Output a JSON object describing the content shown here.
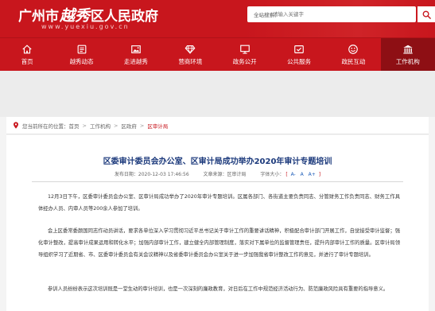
{
  "header": {
    "site_name_prefix": "广州市",
    "site_name_brush": "越秀",
    "site_name_suffix": "区人民政府",
    "domain": "www.yuexiu.gov.cn",
    "search_label": "全站搜索：",
    "search_placeholder": "请输入关键字"
  },
  "nav": {
    "items": [
      {
        "label": "首页",
        "icon": "home-icon"
      },
      {
        "label": "越秀动态",
        "icon": "newspaper-icon"
      },
      {
        "label": "走进越秀",
        "icon": "picture-icon"
      },
      {
        "label": "营商环境",
        "icon": "diamond-icon"
      },
      {
        "label": "政务公开",
        "icon": "monitor-icon"
      },
      {
        "label": "公共服务",
        "icon": "service-icon"
      },
      {
        "label": "政民互动",
        "icon": "interaction-icon"
      },
      {
        "label": "工作机构",
        "icon": "institution-icon"
      }
    ]
  },
  "breadcrumb": {
    "prefix": "您当前所在的位置：",
    "items": [
      "首页",
      "工作机构",
      "区政府"
    ],
    "current": "区审计局"
  },
  "article": {
    "title": "区委审计委员会办公室、区审计局成功举办2020年审计专题培训",
    "date_label": "发布日期：",
    "date": "2020-12-03 17:46:56",
    "source_label": "文章来源：",
    "source": "区审计局",
    "font_label": "字体大小：",
    "font_small": "A-",
    "font_mid": "A",
    "font_large": "A+",
    "paragraphs": [
      "12月3日下午，区委审计委员会办公室、区审计局成功举办了2020年审计专题培训。区属各部门、各街道主要负责同志、分管财务工作负责同志、财务工作具体经办人员、内审人员等200余人参加了培训。",
      "会上区委常委颜国同志作动员讲话，要求各单位深入学习贯彻习近平总书记关于审计工作的重要讲话精神，积极配合审计部门开展工作，自觉接受审计监督；强化审计整改，提高审计成果运用和转化水平；加强内部审计工作，建立健全内部管理制度，落实对下属单位的监督管理责任，提升内部审计工作的质量。区审计局领导组织学习了近期省、市、区委审计委员会有关会议精神以及省委审计委员会办公室关于进一步加强我省审计整改工作的意见，并进行了审计专题培训。",
      "参训人员纷纷表示这次培训既是一堂生动的审计培训，也是一次深刻的廉政教育，对日后在工作中规范经济活动行为、防范廉政风险具有重要的指导意义。"
    ]
  },
  "colors": {
    "brand_red": "#c8161d",
    "title_blue": "#1c3a7c",
    "active_nav": "#8e0f14"
  }
}
